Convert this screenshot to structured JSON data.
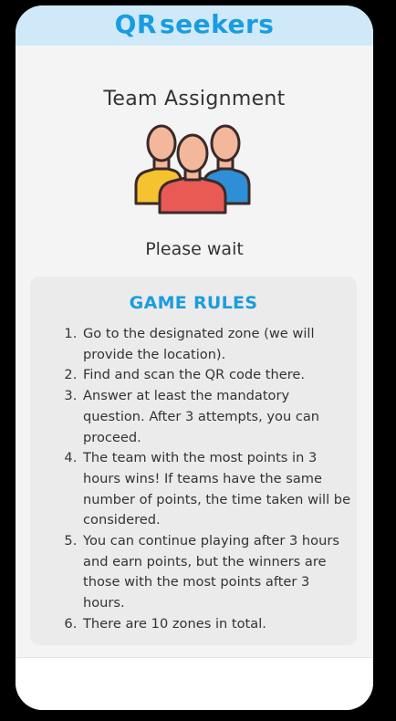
{
  "header": {
    "logo_qr": "QR",
    "logo_seekers": "seekers"
  },
  "screen": {
    "title": "Team Assignment",
    "team_icon": "team-group-icon",
    "status": "Please wait"
  },
  "rules": {
    "heading": "GAME RULES",
    "items": [
      "Go to the designated zone (we will provide the location).",
      "Find and scan the QR code there.",
      "Answer at least the mandatory question. After 3 attempts, you can proceed.",
      "The team with the most points in 3 hours wins! If teams have the same number of points, the time taken will be considered.",
      "You can continue playing after 3 hours and earn points, but the winners are those with the most points after 3 hours.",
      "There are 10 zones in total."
    ]
  },
  "colors": {
    "brand": "#1a9ce0",
    "header_bg": "#cfe9f9",
    "content_bg": "#f4f4f4",
    "card_bg": "#ecebeb"
  }
}
